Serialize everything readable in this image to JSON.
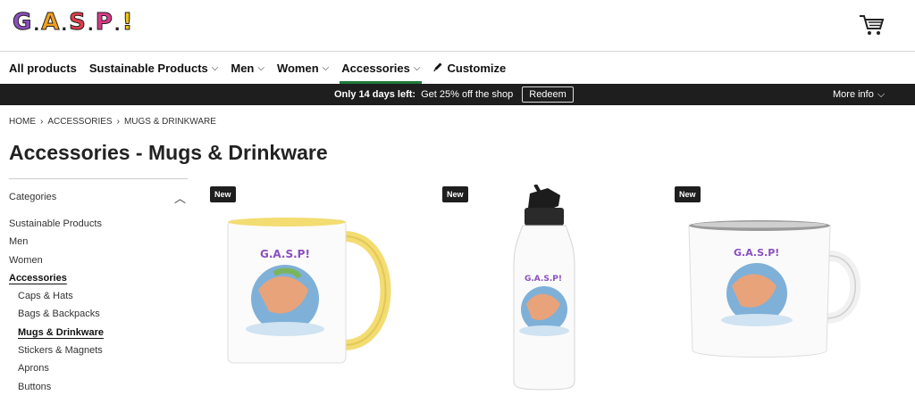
{
  "header": {
    "logo_letters": [
      {
        "char": "G",
        "color": "#8b4fbf"
      },
      {
        "char": "A",
        "color": "#f0a020"
      },
      {
        "char": "S",
        "color": "#e23a4a"
      },
      {
        "char": "P",
        "color": "#d93a88"
      },
      {
        "char": "!",
        "color": "#f2c21b"
      }
    ],
    "logo_dot": ".",
    "cart_icon": "shopping-cart-icon"
  },
  "nav": {
    "items": [
      {
        "label": "All products",
        "has_chevron": false
      },
      {
        "label": "Sustainable Products",
        "has_chevron": true
      },
      {
        "label": "Men",
        "has_chevron": true
      },
      {
        "label": "Women",
        "has_chevron": true
      },
      {
        "label": "Accessories",
        "has_chevron": true,
        "active": true
      },
      {
        "label": "Customize",
        "has_chevron": false,
        "icon": "pencil-icon"
      }
    ],
    "chevron": "⌵",
    "active_color": "#1f7a3a"
  },
  "promo": {
    "bold_text": "Only 14 days left:",
    "text": "Get 25% off the shop",
    "redeem_label": "Redeem",
    "more_info_label": "More info",
    "chevron": "⌵"
  },
  "breadcrumb": {
    "items": [
      "HOME",
      "ACCESSORIES",
      "MUGS & DRINKWARE"
    ],
    "separator": "›"
  },
  "page_title": "Accessories - Mugs & Drinkware",
  "sidebar": {
    "heading": "Categories",
    "toggle": "︿",
    "items": [
      {
        "label": "Sustainable Products",
        "sub": false
      },
      {
        "label": "Men",
        "sub": false
      },
      {
        "label": "Women",
        "sub": false
      },
      {
        "label": "Accessories",
        "sub": false,
        "current": true
      },
      {
        "label": "Caps & Hats",
        "sub": true
      },
      {
        "label": "Bags & Backpacks",
        "sub": true
      },
      {
        "label": "Mugs & Drinkware",
        "sub": true,
        "current": true
      },
      {
        "label": "Stickers & Magnets",
        "sub": true
      },
      {
        "label": "Aprons",
        "sub": true
      },
      {
        "label": "Buttons",
        "sub": true
      }
    ]
  },
  "products": [
    {
      "badge": "New",
      "kind": "mug",
      "handle_color": "#f3dc72"
    },
    {
      "badge": "New",
      "kind": "bottle"
    },
    {
      "badge": "New",
      "kind": "enamel-mug"
    }
  ]
}
